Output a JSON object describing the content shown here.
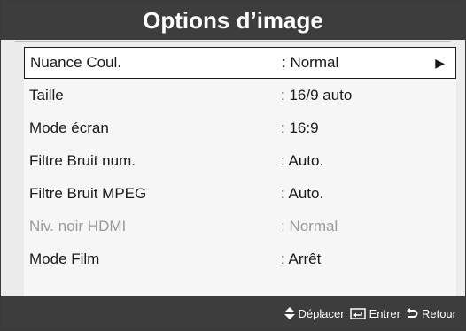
{
  "title": "Options d’image",
  "items": [
    {
      "label": "Nuance Coul.",
      "value": ": Normal",
      "selected": true,
      "disabled": false
    },
    {
      "label": "Taille",
      "value": ": 16/9 auto",
      "selected": false,
      "disabled": false
    },
    {
      "label": "Mode écran",
      "value": ": 16:9",
      "selected": false,
      "disabled": false
    },
    {
      "label": "Filtre Bruit num.",
      "value": ": Auto.",
      "selected": false,
      "disabled": false
    },
    {
      "label": "Filtre Bruit MPEG",
      "value": ": Auto.",
      "selected": false,
      "disabled": false
    },
    {
      "label": "Niv. noir HDMI",
      "value": ": Normal",
      "selected": false,
      "disabled": true
    },
    {
      "label": "Mode Film",
      "value": ": Arrêt",
      "selected": false,
      "disabled": false
    }
  ],
  "selected_arrow": "▶",
  "scroll_indicator": "▼",
  "footer": {
    "move_label": "Déplacer",
    "enter_label": "Entrer",
    "return_label": "Retour"
  },
  "icons": {
    "move": "up-down-diamond-icon",
    "enter": "enter-key-icon",
    "return": "return-arrow-icon"
  },
  "colors": {
    "bar": "#3d3d3d",
    "panel": "#ececec",
    "text": "#1a1a1a",
    "disabled_text": "#9a9a9a"
  }
}
